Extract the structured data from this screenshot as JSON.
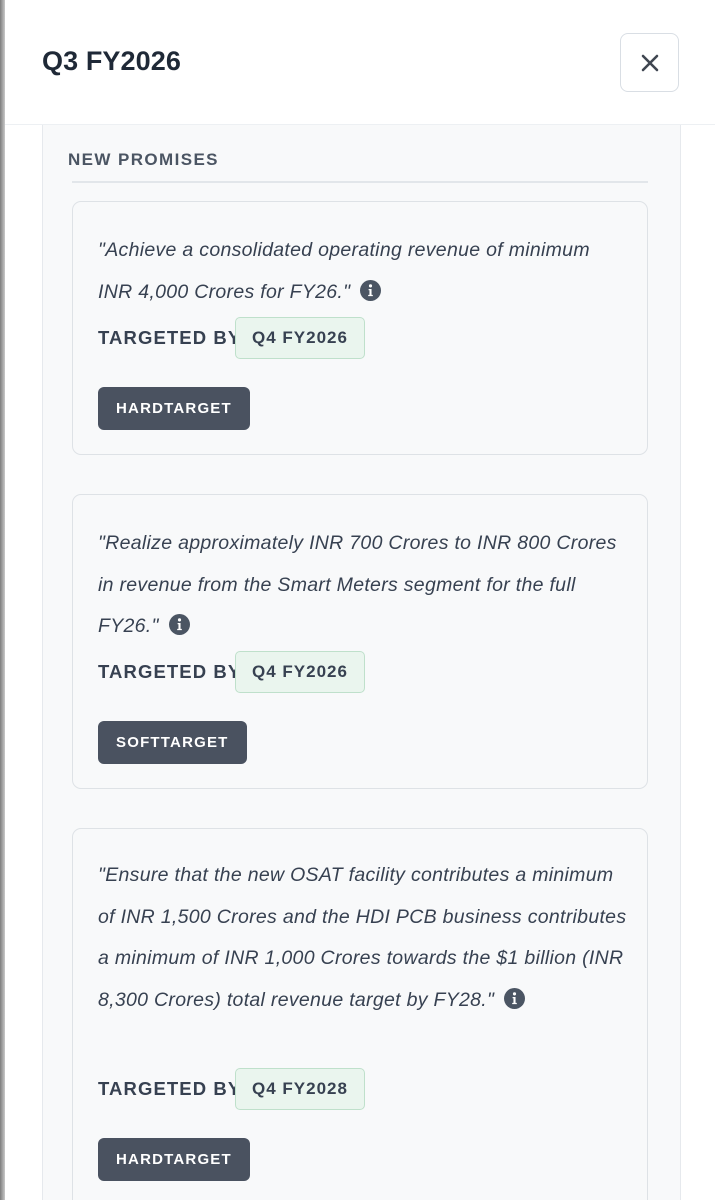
{
  "header": {
    "title": "Q3 FY2026",
    "close_icon": "close-icon"
  },
  "section": {
    "title": "NEW PROMISES"
  },
  "promises": [
    {
      "quote": "\"Achieve a consolidated operating revenue of minimum INR 4,000 Crores for FY26.\"",
      "targeted_by_label": "TARGETED BY",
      "targeted_by": "Q4 FY2026",
      "type": "HARDTARGET"
    },
    {
      "quote": "\"Realize approximately INR 700 Crores to INR 800 Crores in revenue from the Smart Meters segment for the full FY26.\"",
      "targeted_by_label": "TARGETED BY",
      "targeted_by": "Q4 FY2026",
      "type": "SOFTTARGET"
    },
    {
      "quote": "\"Ensure that the new OSAT facility contributes a minimum of INR 1,500 Crores and the HDI PCB business contributes a minimum of INR 1,000 Crores towards the $1 billion (INR 8,300 Crores) total revenue target by FY28.\"",
      "targeted_by_label": "TARGETED BY",
      "targeted_by": "Q4 FY2028",
      "type": "HARDTARGET"
    }
  ],
  "colors": {
    "badge_dark": "#4a5260",
    "badge_green_bg": "#eaf5ee",
    "badge_green_border": "#bfe0cb",
    "card_bg": "#f8f9fa"
  },
  "icons": {
    "info": "info-icon"
  }
}
